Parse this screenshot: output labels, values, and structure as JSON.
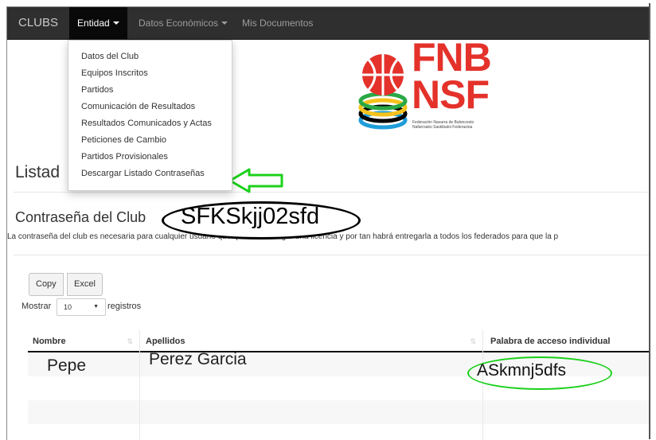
{
  "navbar": {
    "brand": "CLUBS",
    "items": [
      {
        "label": "Entidad",
        "active": true
      },
      {
        "label": "Datos Económicos",
        "active": false
      },
      {
        "label": "Mis Documentos",
        "active": false
      }
    ]
  },
  "dropdown": {
    "items": [
      "Datos del Club",
      "Equipos Inscritos",
      "Partidos",
      "Comunicación de Resultados",
      "Resultados Comunicados y Actas",
      "Peticiones de Cambio",
      "Partidos Provisionales",
      "Descargar Listado Contraseñas"
    ]
  },
  "logo": {
    "line1": "FNB",
    "line2": "NSF",
    "sub1": "Federación Navarra de Baloncesto",
    "sub2": "Nafarroako Saskibaloi Federazioa"
  },
  "page": {
    "title": "Listad",
    "section_title": "Contraseña del Club",
    "hint": "La contraseña del club es necesaria para cualquier usuario que quiera descargar una licencia y por tan habrá entregarla a todos los federados para que la p"
  },
  "annotations": {
    "club_password": "SFKSkjj02sfd",
    "access_password": "ASkmnj5dfs"
  },
  "toolbar": {
    "copy_label": "Copy",
    "excel_label": "Excel"
  },
  "length": {
    "prefix": "Mostrar",
    "value": "10",
    "suffix": "registros"
  },
  "table": {
    "headers": [
      "Nombre",
      "Apellidos",
      "Palabra de acceso individual"
    ],
    "rows": [
      {
        "nombre": "Pepe",
        "apellidos": "Perez Garcia",
        "palabra": "ASkmnj5dfs"
      }
    ]
  },
  "colors": {
    "navbar_bg": "#2f2f2f",
    "highlight_green": "#1bd11b",
    "logo_red": "#e4322b"
  }
}
